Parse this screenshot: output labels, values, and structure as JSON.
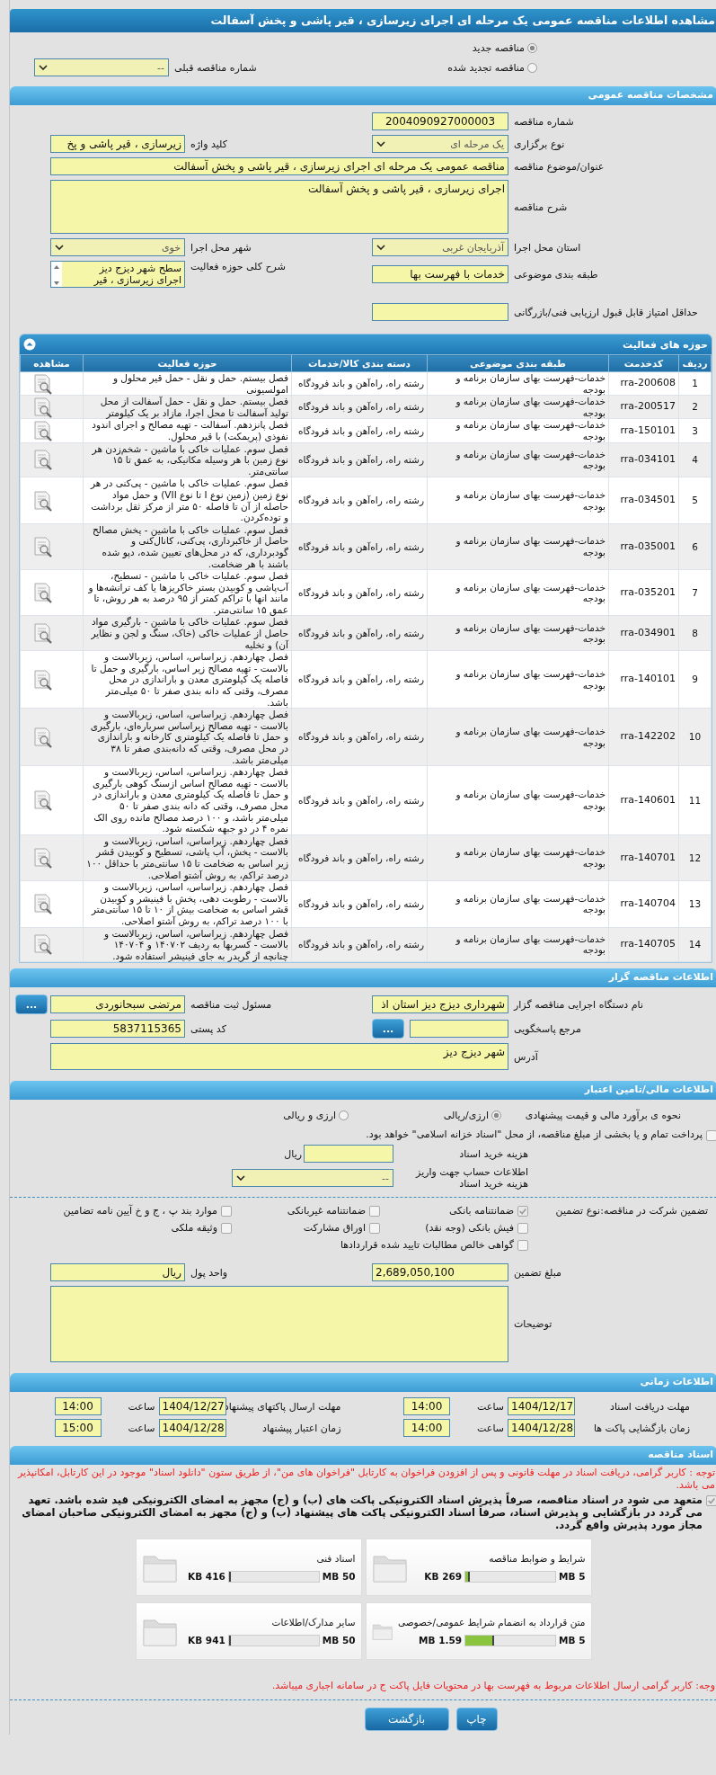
{
  "title": "مشاهده اطلاعات مناقصه عمومی یک مرحله ای اجرای زیرسازی ، قیر پاشی و پخش آسفالت",
  "tender_status": [
    {
      "label": "مناقصه جدید",
      "selected": true
    },
    {
      "label": "مناقصه تجدید شده",
      "selected": false
    }
  ],
  "previous_tender": {
    "label": "شماره مناقصه قبلی",
    "value": "--"
  },
  "general": {
    "header": "مشخصات مناقصه عمومی",
    "tender_number": {
      "label": "شماره مناقصه",
      "value": "2004090927000003"
    },
    "holding_type": {
      "label": "نوع برگزاری",
      "value": "یک مرحله ای"
    },
    "keyword": {
      "label": "کلید واژه",
      "value": "زیرسازی ، قیر پاشی و پخ"
    },
    "subject": {
      "label": "عنوان/موضوع مناقصه",
      "value": "مناقصه عمومی یک مرحله ای اجرای زیرسازی ، قیر پاشی و پخش آسفالت"
    },
    "description": {
      "label": "شرح مناقصه",
      "value": "اجرای زیرسازی ، قیر پاشی و پخش آسفالت"
    },
    "province": {
      "label": "استان محل اجرا",
      "value": "آذربایجان غربی"
    },
    "city": {
      "label": "شهر محل اجرا",
      "value": "خوی"
    },
    "category": {
      "label": "طبقه بندی موضوعی",
      "value": "خدمات با فهرست بها"
    },
    "scope": {
      "label": "شرح کلی حوزه فعالیت",
      "lines": [
        "سطح شهر دیزج دیز",
        "اجرای زیرسازی ، قیر"
      ]
    },
    "min_score": {
      "label": "حداقل امتیاز قابل قبول ارزیابی فنی/بازرگانی"
    }
  },
  "activities": {
    "header": "حوزه های فعالیت",
    "expanded": true,
    "columns": [
      "ردیف",
      "کدخدمت",
      "طبقه بندی موضوعی",
      "دسته بندی کالا/خدمات",
      "حوزه فعالیت",
      "مشاهده"
    ],
    "rows": [
      {
        "index": "1",
        "code": "rra-200608",
        "category": "خدمات-فهرست بهای سازمان برنامه و بودجه",
        "group": "رشته راه، راه‌آهن و باند فرودگاه",
        "scope": "فصل بیستم. حمل و نقل - حمل قیر محلول و امولسیونی"
      },
      {
        "index": "2",
        "code": "rra-200517",
        "category": "خدمات-فهرست بهای سازمان برنامه و بودجه",
        "group": "رشته راه، راه‌آهن و باند فرودگاه",
        "scope": "فصل بیستم. حمل و نقل - حمل آسفالت از محل تولید آسفالت تا محل اجرا، مازاد بر یک کیلومتر"
      },
      {
        "index": "3",
        "code": "rra-150101",
        "category": "خدمات-فهرست بهای سازمان برنامه و بودجه",
        "group": "رشته راه، راه‌آهن و باند فرودگاه",
        "scope": "فصل پانزدهم. آسفالت - تهیه مصالح و اجرای اندود نفوذی (پریمکت) با قیر محلول."
      },
      {
        "index": "4",
        "code": "rra-034101",
        "category": "خدمات-فهرست بهای سازمان برنامه و بودجه",
        "group": "رشته راه، راه‌آهن و باند فرودگاه",
        "scope": "فصل سوم. عملیات خاکی با ماشین - شخم‌زدن هر نوع زمین با هر وسیله مکانیکی، به عمق تا ۱۵ سانتی‌متر."
      },
      {
        "index": "5",
        "code": "rra-034501",
        "category": "خدمات-فهرست بهای سازمان برنامه و بودجه",
        "group": "رشته راه، راه‌آهن و باند فرودگاه",
        "scope": "فصل سوم. عملیات خاکی با ماشین - پی‌کنی در هر نوع زمین (زمین نوع I تا نوع VII) و حمل مواد حاصله از آن تا فاصله ۵۰ متر از مرکز ثقل برداشت و توده‌کردن."
      },
      {
        "index": "6",
        "code": "rra-035001",
        "category": "خدمات-فهرست بهای سازمان برنامه و بودجه",
        "group": "رشته راه، راه‌آهن و باند فرودگاه",
        "scope": "فصل سوم. عملیات خاکی با ماشین - پخش مصالح حاصل از خاکبرداری، پی‌کنی، کانال‌کنی و گودبرداری، که در محل‌های تعیین شده، دپو شده باشند با هر ضخامت."
      },
      {
        "index": "7",
        "code": "rra-035201",
        "category": "خدمات-فهرست بهای سازمان برنامه و بودجه",
        "group": "رشته راه، راه‌آهن و باند فرودگاه",
        "scope": "فصل سوم. عملیات خاکی با ماشین - تسطیح، آب‌پاشی و کوبیدن بستر خاکریزها یا کف ترانشه‌ها و مانند انها با تراکم کمتر از ۹۵ درصد به هر روش، تا عمق ۱۵ سانتی‌متر."
      },
      {
        "index": "8",
        "code": "rra-034901",
        "category": "خدمات-فهرست بهای سازمان برنامه و بودجه",
        "group": "رشته راه، راه‌آهن و باند فرودگاه",
        "scope": "فصل سوم. عملیات خاکی با ماشین - بارگیری مواد حاصل از عملیات خاکی (خاک، سنگ و لجن و نظایر آن) و تخلیه"
      },
      {
        "index": "9",
        "code": "rra-140101",
        "category": "خدمات-فهرست بهای سازمان برنامه و بودجه",
        "group": "رشته راه، راه‌آهن و باند فرودگاه",
        "scope": "فصل چهاردهم. زیراساس، اساس، زیربالاست و بالاست - تهیه مصالح زیر اساس، بارگیری و حمل تا فاصله یک کیلومتری معدن و باراندازی در محل مصرف، وقتی که دانه بندی صفر تا ۵۰ میلی‌متر باشد."
      },
      {
        "index": "10",
        "code": "rra-142202",
        "category": "خدمات-فهرست بهای سازمان برنامه و بودجه",
        "group": "رشته راه، راه‌آهن و باند فرودگاه",
        "scope": "فصل چهاردهم. زیراساس، اساس، زیربالاست و بالاست - تهیه مصالح زیراساس سرباره‌ای، بارگیری و حمل تا فاصله یک کیلومتری کارخانه و باراندازی در محل مصرف، وقتی که دانه‌بندی صفر تا ۳۸ میلی‌متر باشد."
      },
      {
        "index": "11",
        "code": "rra-140601",
        "category": "خدمات-فهرست بهای سازمان برنامه و بودجه",
        "group": "رشته راه، راه‌آهن و باند فرودگاه",
        "scope": "فصل چهاردهم. زیراساس، اساس، زیربالاست و بالاست - تهیه مصالح اساس ازسنگ کوهی بارگیری و حمل تا فاصله یک کیلومتری معدن و باراندازی در محل مصرف، وقتی که دانه بندی صفر تا ۵۰ میلی‌متر باشد، و ۱۰۰ درصد مصالح مانده روی الک نمره ۴ در دو جبهه شکسته شود."
      },
      {
        "index": "12",
        "code": "rra-140701",
        "category": "خدمات-فهرست بهای سازمان برنامه و بودجه",
        "group": "رشته راه، راه‌آهن و باند فرودگاه",
        "scope": "فصل چهاردهم. زیراساس، اساس، زیربالاست و بالاست - پخش، آب پاشی، تسطیح و کوبیدن قشر زیر اساس به ضخامت تا ۱۵ سانتی‌متر با حداقل ۱۰۰ درصد تراکم، به روش آشتو اصلاحی."
      },
      {
        "index": "13",
        "code": "rra-140704",
        "category": "خدمات-فهرست بهای سازمان برنامه و بودجه",
        "group": "رشته راه، راه‌آهن و باند فرودگاه",
        "scope": "فصل چهاردهم. زیراساس، اساس، زیربالاست و بالاست - رطوبت دهی، پخش با فینیشر و کوبیدن قشر اساس به ضخامت بیش از ۱۰ تا ۱۵ سانتی‌متر با ۱۰۰ درصد تراکم، به روش آشتو اصلاحی."
      },
      {
        "index": "14",
        "code": "rra-140705",
        "category": "خدمات-فهرست بهای سازمان برنامه و بودجه",
        "group": "رشته راه، راه‌آهن و باند فرودگاه",
        "scope": "فصل چهاردهم. زیراساس، اساس، زیربالاست و بالاست - کسربها به ردیف ۱۴۰۷۰۲ و ۱۴۰۷۰۴ چنانچه از گریدر به جای فینیشر استفاده شود."
      }
    ]
  },
  "tenderer": {
    "header": "اطلاعات مناقصه گزار",
    "organization": {
      "label": "نام دستگاه اجرایی مناقصه گزار",
      "value": "شهرداری دیزج دیز استان اذ"
    },
    "registrar": {
      "label": "مسئول ثبت مناقصه",
      "value": "مرتضی سبحانوردی",
      "button": "..."
    },
    "reference": {
      "label": "مرجع پاسخگویی",
      "button": "..."
    },
    "postal_code": {
      "label": "کد پستی",
      "value": "5837115365"
    },
    "address": {
      "label": "آدرس",
      "value": "شهر دیزج دیز"
    }
  },
  "finance": {
    "header": "اطلاعات مالی/تامین اعتبار",
    "estimate": {
      "label": "نحوه ی برآورد مالی و قیمت پیشنهادی",
      "options": [
        {
          "label": "ارزی/ریالی",
          "selected": true
        },
        {
          "label": "ارزی و ریالی",
          "selected": false
        }
      ]
    },
    "treasury": {
      "label": "پرداخت تمام و یا بخشی از مبلغ مناقصه، از محل \"اسناد خزانه اسلامی\" خواهد بود.",
      "checked": false
    },
    "doc_cost": {
      "label": "هزینه خرید اسناد",
      "unit": "ریال"
    },
    "account": {
      "label": "اطلاعات حساب جهت واریز هزینه خرید اسناد",
      "value": "--"
    },
    "guarantee_label": "تضمین شرکت در مناقصه:",
    "guarantee_type_label": "نوع تضمین",
    "guarantee_options": [
      {
        "label": "ضمانتنامه بانکی",
        "checked": true
      },
      {
        "label": "ضمانتنامه غیربانکی",
        "checked": false
      },
      {
        "label": "موارد بند پ ، ج و خ آیین نامه تضامین",
        "checked": false
      },
      {
        "label": "فیش بانکی (وجه نقد)",
        "checked": false
      },
      {
        "label": "اوراق مشارکت",
        "checked": false
      },
      {
        "label": "وثیقه ملکی",
        "checked": false
      },
      {
        "label": "گواهی خالص مطالبات تایید شده قراردادها",
        "checked": false
      }
    ],
    "amount": {
      "label": "مبلغ تضمین",
      "value": "2,689,050,100"
    },
    "currency": {
      "label": "واحد پول",
      "value": "ریال"
    },
    "notes": {
      "label": "توضیحات"
    }
  },
  "schedule": {
    "header": "اطلاعات زمانی",
    "items": [
      {
        "label": "مهلت دریافت اسناد",
        "date": "1404/12/17",
        "time_label": "ساعت",
        "time": "14:00"
      },
      {
        "label": "مهلت ارسال پاکتهای پیشنهاد",
        "date": "1404/12/27",
        "time_label": "ساعت",
        "time": "14:00"
      },
      {
        "label": "زمان بازگشایی پاکت ها",
        "date": "1404/12/28",
        "time_label": "ساعت",
        "time": "14:00"
      },
      {
        "label": "زمان اعتبار پیشنهاد",
        "date": "1404/12/28",
        "time_label": "ساعت",
        "time": "15:00"
      }
    ]
  },
  "documents": {
    "header": "اسناد مناقصه",
    "notice": "توجه : کاربر گرامی، دریافت اسناد در مهلت قانونی و پس از افزودن فراخوان به کارتابل \"فراخوان های من\"، از طریق ستون \"دانلود اسناد\" موجود در این کارتابل، امکانپذیر می باشد.",
    "commitment": {
      "text": "متعهد می شود در اسناد مناقصه، صرفاً پذیرش اسناد الکترونیکی پاکت های (ب) و (ج) مجهز به امضای الکترونیکی قید شده باشد. تعهد می گردد در بازگشایی و پذیرش اسناد، صرفاً اسناد الکترونیکی پاکت های پیشنهاد (ب) و (ج) مجهز به امضای الکترونیکی صاحبان امضای مجاز مورد پذیرش واقع گردد.",
      "checked": true
    },
    "files": [
      {
        "title": "شرایط و ضوابط مناقصه",
        "used": "269 KB",
        "max": "5 MB",
        "level": 0.05
      },
      {
        "title": "اسناد فنی",
        "used": "416 KB",
        "max": "50 MB",
        "level": 0.01
      },
      {
        "title": "متن قرارداد به انضمام شرایط عمومی/خصوصی",
        "used": "1.59 MB",
        "max": "5 MB",
        "level": 0.32
      },
      {
        "title": "سایر مدارک/اطلاعات",
        "used": "941 KB",
        "max": "50 MB",
        "level": 0.02
      }
    ]
  },
  "footer_notice": "وجه: کاربر گرامی ارسال اطلاعات مربوط به فهرست بها در محتویات فایل پاکت ج در سامانه اجباری میباشد.",
  "buttons": [
    "چاپ",
    "بازگشت"
  ]
}
